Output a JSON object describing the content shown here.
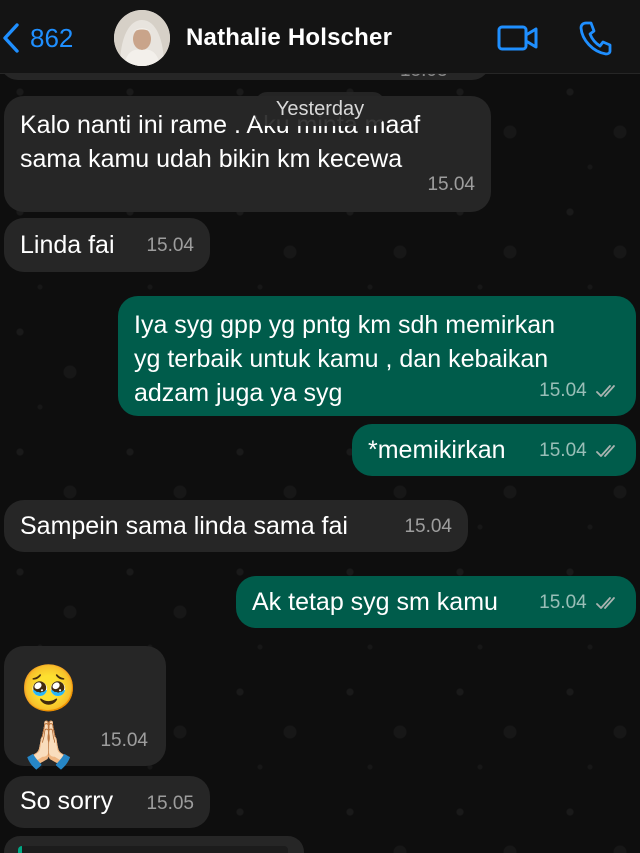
{
  "header": {
    "back_count": "862",
    "contact_name": "Nathalie Holscher"
  },
  "date_pill": "Yesterday",
  "top_partial_time": "15.03",
  "messages": [
    {
      "dir": "in",
      "lines": [
        "Kalo nanti ini rame . Aku minta maaf",
        "sama kamu udah bikin km kecewa"
      ],
      "time": "15.04"
    },
    {
      "dir": "in",
      "lines": [
        "Linda fai"
      ],
      "time": "15.04"
    },
    {
      "dir": "out",
      "lines": [
        "Iya syg gpp yg pntg km sdh memirkan",
        "yg terbaik untuk kamu , dan kebaikan",
        "adzam juga ya syg"
      ],
      "time": "15.04",
      "status": "read"
    },
    {
      "dir": "out",
      "lines": [
        "*memikirkan"
      ],
      "time": "15.04",
      "status": "read"
    },
    {
      "dir": "in",
      "lines": [
        "Sampein sama linda sama fai"
      ],
      "time": "15.04"
    },
    {
      "dir": "out",
      "lines": [
        "Ak tetap syg sm kamu"
      ],
      "time": "15.04",
      "status": "read"
    },
    {
      "dir": "in",
      "lines": [
        "🥹 🙏🏻"
      ],
      "time": "15.04"
    },
    {
      "dir": "in",
      "lines": [
        "So sorry"
      ],
      "time": "15.05"
    }
  ],
  "colors": {
    "accent": "#1f8fff",
    "incoming_bubble": "#262626",
    "outgoing_bubble": "#005c4b",
    "read_ticks": "#a9b3b0"
  },
  "icons": [
    "chevron-left-icon",
    "video-call-icon",
    "phone-call-icon",
    "double-check-icon"
  ]
}
